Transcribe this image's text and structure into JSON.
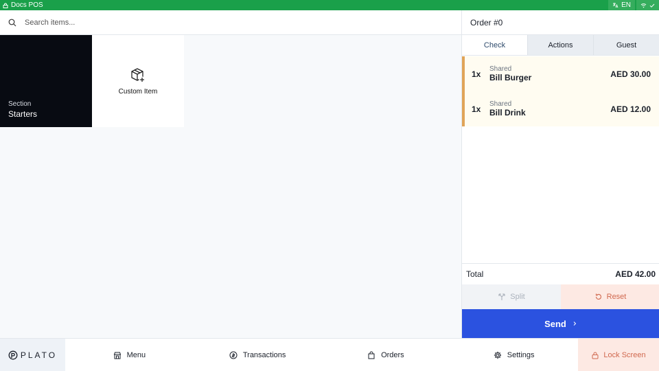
{
  "statusbar": {
    "app_name": "Docs POS",
    "language": "EN"
  },
  "search": {
    "placeholder": "Search items..."
  },
  "tiles": {
    "section": {
      "caption": "Section",
      "name": "Starters"
    },
    "custom": {
      "label": "Custom Item"
    }
  },
  "order": {
    "title": "Order #0",
    "tabs": [
      "Check",
      "Actions",
      "Guest"
    ],
    "active_tab": "Check",
    "items": [
      {
        "qty": "1x",
        "who": "Shared",
        "name": "Bill Burger",
        "price": "AED 30.00"
      },
      {
        "qty": "1x",
        "who": "Shared",
        "name": "Bill Drink",
        "price": "AED 12.00"
      }
    ],
    "total_label": "Total",
    "total_value": "AED 42.00",
    "split_label": "Split",
    "reset_label": "Reset",
    "send_label": "Send"
  },
  "nav": {
    "brand": "PLATO",
    "menu": "Menu",
    "transactions": "Transactions",
    "orders": "Orders",
    "settings": "Settings",
    "lock": "Lock Screen"
  },
  "colors": {
    "statusbar": "#1aa04a",
    "send": "#2b52e0",
    "reset": "#d0684e",
    "item_accent": "#e0a458"
  }
}
